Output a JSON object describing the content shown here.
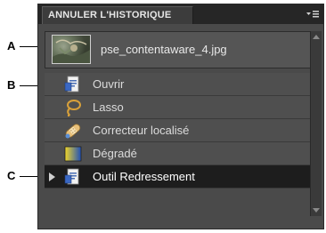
{
  "panel": {
    "title": "ANNULER L'HISTORIQUE",
    "menu_icon": "panel-menu-icon"
  },
  "snapshot": {
    "filename": "pse_contentaware_4.jpg"
  },
  "history": {
    "items": [
      {
        "label": "Ouvrir",
        "icon": "document-icon"
      },
      {
        "label": "Lasso",
        "icon": "lasso-icon"
      },
      {
        "label": "Correcteur localisé",
        "icon": "bandage-icon"
      },
      {
        "label": "Dégradé",
        "icon": "gradient-icon"
      },
      {
        "label": "Outil Redressement",
        "icon": "document-icon",
        "selected": true
      }
    ]
  },
  "callouts": {
    "a": "A",
    "b": "B",
    "c": "C"
  }
}
